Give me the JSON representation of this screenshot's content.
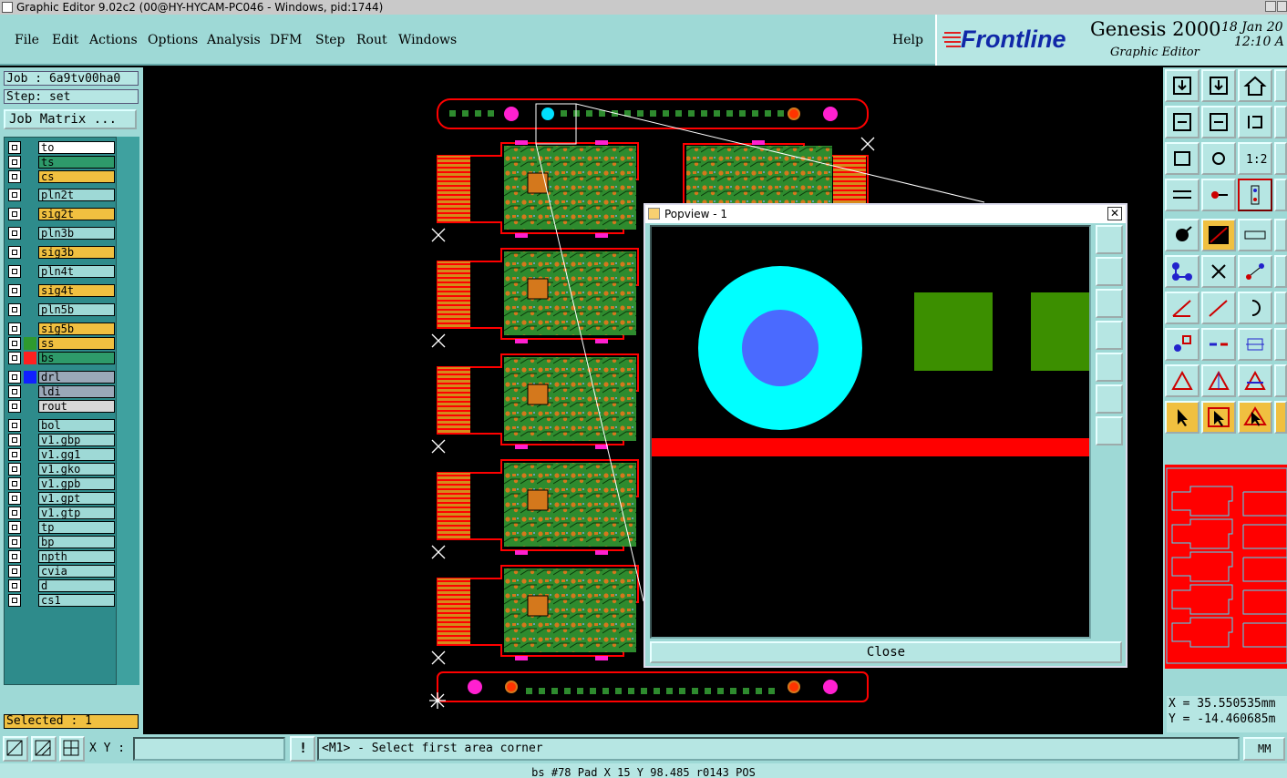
{
  "window": {
    "title": "Graphic Editor 9.02c2 (00@HY-HYCAM-PC046 - Windows, pid:1744)"
  },
  "menu": [
    "File",
    "Edit",
    "Actions",
    "Options",
    "Analysis",
    "DFM",
    "Step",
    "Rout",
    "Windows"
  ],
  "help_label": "Help",
  "brand": {
    "logo": "Frontline",
    "product": "Genesis 2000",
    "subtitle": "Graphic Editor",
    "date": "18 Jan 20",
    "time": "12:10 A"
  },
  "job": {
    "job_label": "Job : 6a9tv00ha0",
    "step_label": "Step: set",
    "matrix_button": "Job Matrix ..."
  },
  "layers": [
    {
      "name": "to",
      "color": "#ffffff",
      "swatch": ""
    },
    {
      "name": "ts",
      "color": "#2e9a6a",
      "swatch": ""
    },
    {
      "name": "cs",
      "color": "#f0c040",
      "swatch": ""
    },
    {
      "name": "pln2t",
      "color": "#9ed9d6",
      "swatch": ""
    },
    {
      "name": "sig2t",
      "color": "#f0c040",
      "swatch": ""
    },
    {
      "name": "pln3b",
      "color": "#9ed9d6",
      "swatch": ""
    },
    {
      "name": "sig3b",
      "color": "#f0c040",
      "swatch": ""
    },
    {
      "name": "pln4t",
      "color": "#9ed9d6",
      "swatch": ""
    },
    {
      "name": "sig4t",
      "color": "#f0c040",
      "swatch": ""
    },
    {
      "name": "pln5b",
      "color": "#9ed9d6",
      "swatch": ""
    },
    {
      "name": "sig5b",
      "color": "#f0c040",
      "swatch": ""
    },
    {
      "name": "ss",
      "color": "#f0c040",
      "swatch": "#2e9a2e"
    },
    {
      "name": "bs",
      "color": "#2e9a6a",
      "swatch": "#ff2020"
    },
    {
      "name": "drl",
      "color": "#9aa8b8",
      "swatch": "#1020ff"
    },
    {
      "name": "ldi",
      "color": "#9aa8b8",
      "swatch": ""
    },
    {
      "name": "rout",
      "color": "#d8d8d8",
      "swatch": ""
    },
    {
      "name": "bol",
      "color": "#9ed9d6",
      "swatch": ""
    },
    {
      "name": "v1.gbp",
      "color": "#9ed9d6",
      "swatch": ""
    },
    {
      "name": "v1.gg1",
      "color": "#9ed9d6",
      "swatch": ""
    },
    {
      "name": "v1.gko",
      "color": "#9ed9d6",
      "swatch": ""
    },
    {
      "name": "v1.gpb",
      "color": "#9ed9d6",
      "swatch": ""
    },
    {
      "name": "v1.gpt",
      "color": "#9ed9d6",
      "swatch": ""
    },
    {
      "name": "v1.gtp",
      "color": "#9ed9d6",
      "swatch": ""
    },
    {
      "name": "tp",
      "color": "#9ed9d6",
      "swatch": ""
    },
    {
      "name": "bp",
      "color": "#9ed9d6",
      "swatch": ""
    },
    {
      "name": "npth",
      "color": "#9ed9d6",
      "swatch": ""
    },
    {
      "name": "cvia",
      "color": "#9ed9d6",
      "swatch": ""
    },
    {
      "name": "d",
      "color": "#9ed9d6",
      "swatch": ""
    },
    {
      "name": "cs1",
      "color": "#9ed9d6",
      "swatch": ""
    }
  ],
  "selected_label": "Selected : 1",
  "popview": {
    "title": "Popview - 1",
    "close_label": "Close"
  },
  "coords": {
    "x": "X = 35.550535mm",
    "y": "Y = -14.460685m"
  },
  "bottom": {
    "xy_label": "X Y :",
    "xy_value": "",
    "prompt": "<M1> - Select first area corner",
    "units": "MM",
    "status": "bs #78 Pad X 15 Y 98.485 r0143 POS"
  },
  "colors": {
    "panel": "#9ed9d6",
    "board": "#ff0000",
    "copper": "#2e8b2e",
    "pad": "#d4781c",
    "highlight": "#f0c040"
  }
}
